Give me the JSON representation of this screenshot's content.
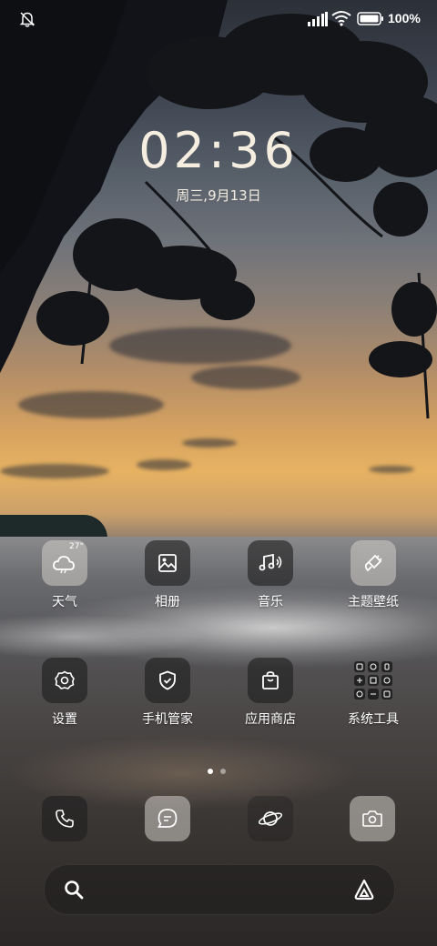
{
  "status_bar": {
    "mute_icon": "bell-muted-icon",
    "signal_icon": "cellular-signal-icon",
    "wifi_icon": "wifi-icon",
    "battery_icon": "battery-icon",
    "battery_percent": "100%"
  },
  "lockscreen": {
    "time": "02:36",
    "date": "周三,9月13日"
  },
  "apps_row1": [
    {
      "label": "天气",
      "icon": "weather-cloud-icon",
      "temp": "27°"
    },
    {
      "label": "相册",
      "icon": "gallery-icon"
    },
    {
      "label": "音乐",
      "icon": "music-icon"
    },
    {
      "label": "主题壁纸",
      "icon": "theme-brush-icon"
    }
  ],
  "apps_row2": [
    {
      "label": "设置",
      "icon": "gear-icon"
    },
    {
      "label": "手机管家",
      "icon": "shield-icon"
    },
    {
      "label": "应用商店",
      "icon": "shopping-bag-icon"
    },
    {
      "label": "系统工具",
      "icon": "folder-grid-icon"
    }
  ],
  "page_indicator": {
    "pages": 2,
    "current": 1
  },
  "dock": [
    {
      "name": "phone",
      "icon": "phone-icon"
    },
    {
      "name": "messages",
      "icon": "message-icon"
    },
    {
      "name": "browser",
      "icon": "planet-icon"
    },
    {
      "name": "camera",
      "icon": "camera-icon"
    }
  ],
  "search_bar": {
    "search_icon": "search-icon",
    "assistant_icon": "assistant-icon"
  },
  "colors": {
    "clock": "#f4ede0",
    "icon_bg": "#1e1e1e"
  }
}
